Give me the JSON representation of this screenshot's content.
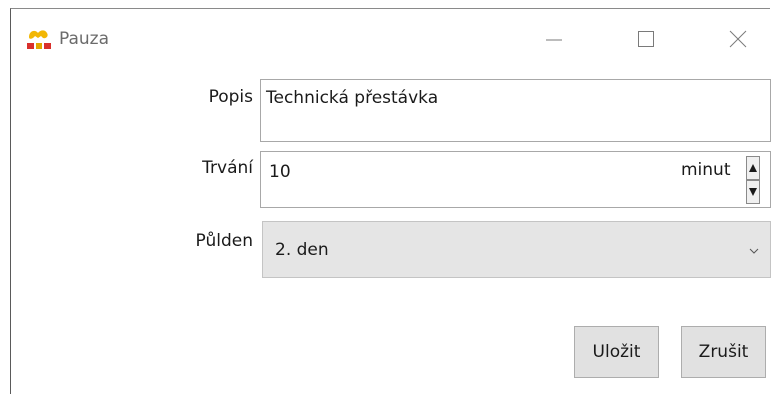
{
  "window": {
    "title": "Pauza",
    "controls": {
      "minimize": "minimize-icon",
      "maximize": "maximize-icon",
      "close": "close-icon"
    }
  },
  "form": {
    "description": {
      "label": "Popis",
      "value": "Technická přestávka"
    },
    "duration": {
      "label": "Trvání",
      "value": "10",
      "unit": "minut"
    },
    "halfday": {
      "label": "Půlden",
      "selected": "2. den"
    }
  },
  "buttons": {
    "save": "Uložit",
    "cancel": "Zrušit"
  },
  "colors": {
    "title_text": "#6b6b6b",
    "button_bg": "#e1e1e1",
    "combo_bg": "#e5e5e5",
    "icon_yellow": "#f2b705",
    "icon_red": "#d9302c"
  }
}
